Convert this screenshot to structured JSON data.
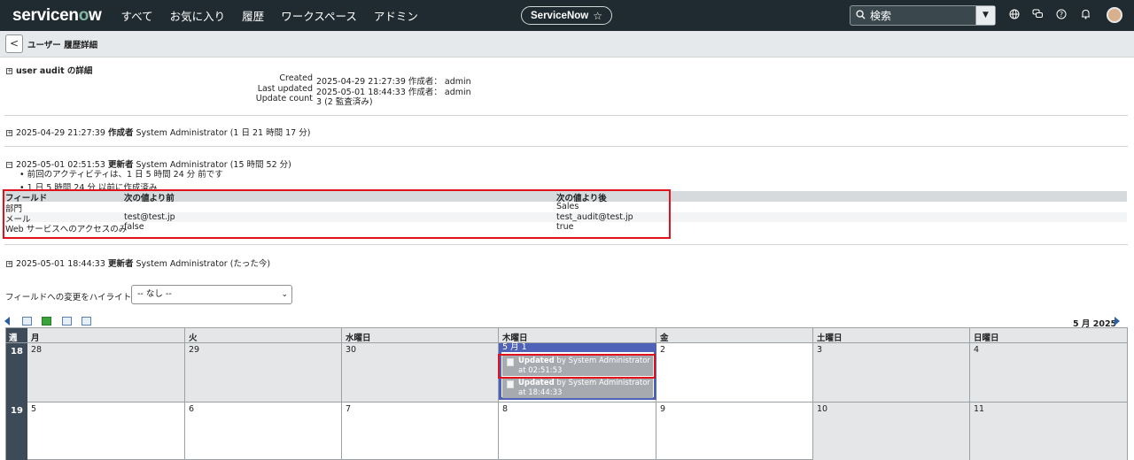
{
  "nav": {
    "logo_pre": "servicen",
    "logo_o": "o",
    "logo_post": "w",
    "menu": [
      "すべて",
      "お気に入り",
      "履歴",
      "ワークスペース",
      "アドミン"
    ],
    "instance": "ServiceNow",
    "star": "☆",
    "search_placeholder": "検索",
    "search_icon": "search-icon",
    "icons": [
      "globe-icon",
      "chat-icon",
      "help-icon",
      "bell-icon"
    ]
  },
  "header": {
    "back": "<",
    "title": "ユーザー 履歴詳細"
  },
  "details": {
    "title_en": "user audit",
    "title_jp": " の詳細",
    "created_label": "Created",
    "created_value": "2025-04-29 21:27:39 作成者： admin",
    "updated_label": "Last updated",
    "updated_value": "2025-05-01 18:44:33 作成者： admin",
    "count_label": "Update count",
    "count_value": "3 (2 監査済み)"
  },
  "entries": [
    {
      "time": "2025-04-29 21:27:39",
      "verb": "作成者",
      "rest": " System Administrator (1 日 21 時間 17 分)"
    },
    {
      "time": "2025-05-01 02:51:53",
      "verb": "更新者",
      "rest": " System Administrator (15 時間 52 分)"
    },
    {
      "time": "2025-05-01 18:44:33",
      "verb": "更新者",
      "rest": " System Administrator (たった今)"
    }
  ],
  "bullets": [
    "前回のアクティビティは、1 日 5 時間 24 分 前です",
    "1 日 5 時間 24 分 以前に作成済み"
  ],
  "diff": {
    "headers": [
      "フィールド",
      "次の値より前",
      "次の値より後"
    ],
    "rows": [
      [
        "部門",
        "",
        "Sales"
      ],
      [
        "メール",
        "test@test.jp",
        "test_audit@test.jp"
      ],
      [
        "Web サービスへのアクセスのみ",
        "false",
        "true"
      ]
    ]
  },
  "highlight": {
    "label": "フィールドへの変更をハイライト:",
    "selected": "-- なし --"
  },
  "calendar": {
    "month_label": "5 月 2025",
    "week_header": "週",
    "days": [
      "月",
      "火",
      "水曜日",
      "木曜日",
      "金",
      "土曜日",
      "日曜日"
    ],
    "weeks": [
      {
        "num": "18",
        "dates": [
          "28",
          "29",
          "30",
          "5 月 1",
          "2",
          "3",
          "4"
        ]
      },
      {
        "num": "19",
        "dates": [
          "5",
          "6",
          "7",
          "8",
          "9",
          "10",
          "11"
        ]
      }
    ],
    "events": [
      {
        "bold": "Updated",
        "text": " by System Administrator at 02:51:53"
      },
      {
        "bold": "Updated",
        "text": " by System Administrator at 18:44:33"
      }
    ]
  },
  "colors": {
    "nav_bg": "#1f2b30",
    "accent_green": "#81b5a1",
    "highlight_red": "#e0121b",
    "today_blue": "#5061b8"
  }
}
